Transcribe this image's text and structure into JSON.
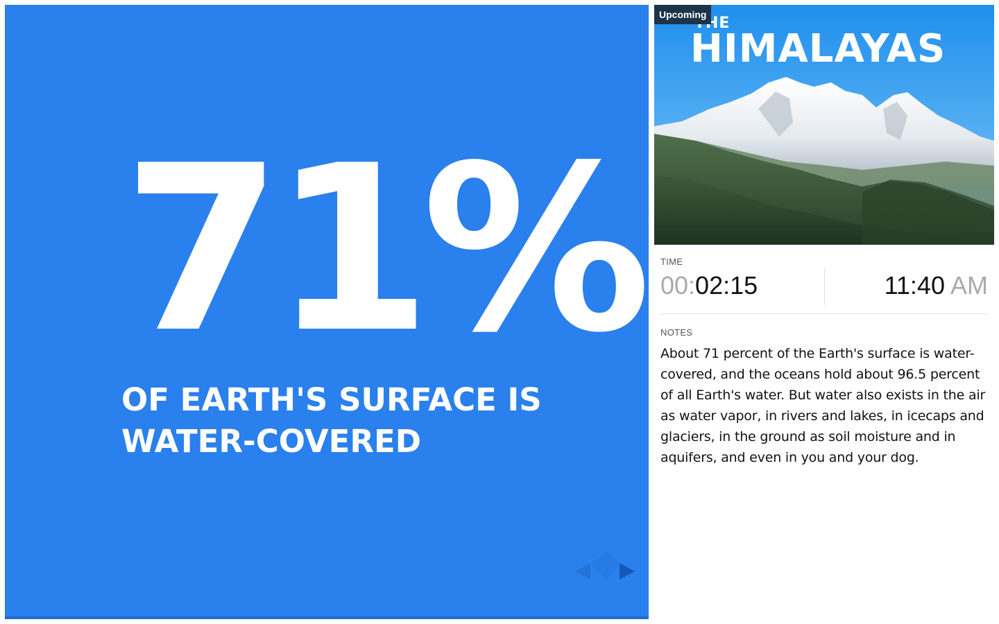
{
  "current_slide": {
    "stat": "71%",
    "caption": "OF EARTH'S SURFACE IS WATER-COVERED",
    "background_color": "#2a80ec",
    "nav": {
      "prev_icon": "triangle-left-icon",
      "next_icon": "triangle-right-icon"
    }
  },
  "upcoming": {
    "badge": "Upcoming",
    "title_small": "THE",
    "title_big": "HIMALAYAS",
    "image": "mountain-landscape"
  },
  "time": {
    "label": "TIME",
    "elapsed_dim": "00:",
    "elapsed": "02:15",
    "clock": "11:40",
    "meridiem": "AM"
  },
  "notes": {
    "label": "NOTES",
    "text": "About 71 percent of the Earth's surface is water-covered, and the oceans hold about 96.5 percent of all Earth's water. But water also exists in the air as water vapor, in rivers and lakes, in icecaps and glaciers, in the ground as soil moisture and in aquifers, and even in you and your dog."
  }
}
